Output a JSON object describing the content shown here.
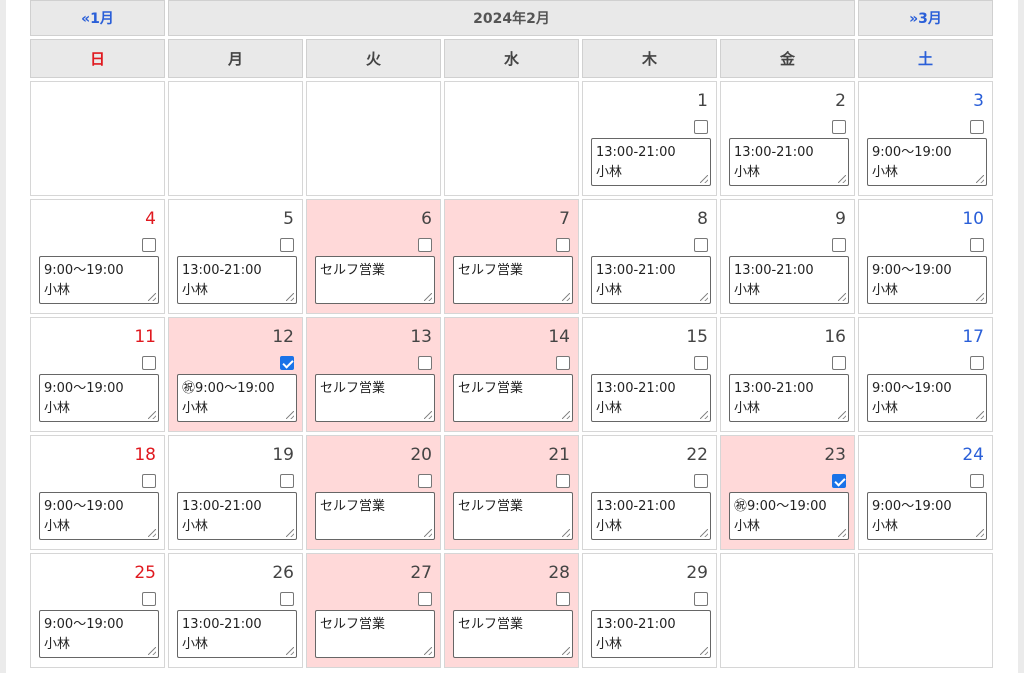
{
  "nav": {
    "prev": "«1月",
    "title": "2024年2月",
    "next": "»3月"
  },
  "weekdays": [
    "日",
    "月",
    "火",
    "水",
    "木",
    "金",
    "土"
  ],
  "weeks": [
    [
      null,
      null,
      null,
      null,
      {
        "day": "1",
        "checked": false,
        "pink": false,
        "line1": "13:00-21:00",
        "line2": "小林"
      },
      {
        "day": "2",
        "checked": false,
        "pink": false,
        "line1": "13:00-21:00",
        "line2": "小林"
      },
      {
        "day": "3",
        "checked": false,
        "pink": false,
        "line1": "9:00～19:00",
        "line2": "小林"
      }
    ],
    [
      {
        "day": "4",
        "checked": false,
        "pink": false,
        "line1": "9:00～19:00",
        "line2": "小林"
      },
      {
        "day": "5",
        "checked": false,
        "pink": false,
        "line1": "13:00-21:00",
        "line2": "小林"
      },
      {
        "day": "6",
        "checked": false,
        "pink": true,
        "line1": "セルフ営業",
        "line2": ""
      },
      {
        "day": "7",
        "checked": false,
        "pink": true,
        "line1": "セルフ営業",
        "line2": ""
      },
      {
        "day": "8",
        "checked": false,
        "pink": false,
        "line1": "13:00-21:00",
        "line2": "小林"
      },
      {
        "day": "9",
        "checked": false,
        "pink": false,
        "line1": "13:00-21:00",
        "line2": "小林"
      },
      {
        "day": "10",
        "checked": false,
        "pink": false,
        "line1": "9:00～19:00",
        "line2": "小林"
      }
    ],
    [
      {
        "day": "11",
        "checked": false,
        "pink": false,
        "line1": "9:00～19:00",
        "line2": "小林"
      },
      {
        "day": "12",
        "checked": true,
        "pink": true,
        "line1": "㊗9:00～19:00",
        "line2": "小林"
      },
      {
        "day": "13",
        "checked": false,
        "pink": true,
        "line1": "セルフ営業",
        "line2": ""
      },
      {
        "day": "14",
        "checked": false,
        "pink": true,
        "line1": "セルフ営業",
        "line2": ""
      },
      {
        "day": "15",
        "checked": false,
        "pink": false,
        "line1": "13:00-21:00",
        "line2": "小林"
      },
      {
        "day": "16",
        "checked": false,
        "pink": false,
        "line1": "13:00-21:00",
        "line2": "小林"
      },
      {
        "day": "17",
        "checked": false,
        "pink": false,
        "line1": "9:00～19:00",
        "line2": "小林"
      }
    ],
    [
      {
        "day": "18",
        "checked": false,
        "pink": false,
        "line1": "9:00～19:00",
        "line2": "小林"
      },
      {
        "day": "19",
        "checked": false,
        "pink": false,
        "line1": "13:00-21:00",
        "line2": "小林"
      },
      {
        "day": "20",
        "checked": false,
        "pink": true,
        "line1": "セルフ営業",
        "line2": ""
      },
      {
        "day": "21",
        "checked": false,
        "pink": true,
        "line1": "セルフ営業",
        "line2": ""
      },
      {
        "day": "22",
        "checked": false,
        "pink": false,
        "line1": "13:00-21:00",
        "line2": "小林"
      },
      {
        "day": "23",
        "checked": true,
        "pink": true,
        "line1": "㊗9:00～19:00",
        "line2": "小林"
      },
      {
        "day": "24",
        "checked": false,
        "pink": false,
        "line1": "9:00～19:00",
        "line2": "小林"
      }
    ],
    [
      {
        "day": "25",
        "checked": false,
        "pink": false,
        "line1": "9:00～19:00",
        "line2": "小林"
      },
      {
        "day": "26",
        "checked": false,
        "pink": false,
        "line1": "13:00-21:00",
        "line2": "小林"
      },
      {
        "day": "27",
        "checked": false,
        "pink": true,
        "line1": "セルフ営業",
        "line2": ""
      },
      {
        "day": "28",
        "checked": false,
        "pink": true,
        "line1": "セルフ営業",
        "line2": ""
      },
      {
        "day": "29",
        "checked": false,
        "pink": false,
        "line1": "13:00-21:00",
        "line2": "小林"
      },
      null,
      null
    ]
  ],
  "colors": {
    "sunday": "#e0191f",
    "saturday": "#2a5fd8",
    "highlight": "#ffd9d9",
    "checked": "#1a73e8"
  }
}
